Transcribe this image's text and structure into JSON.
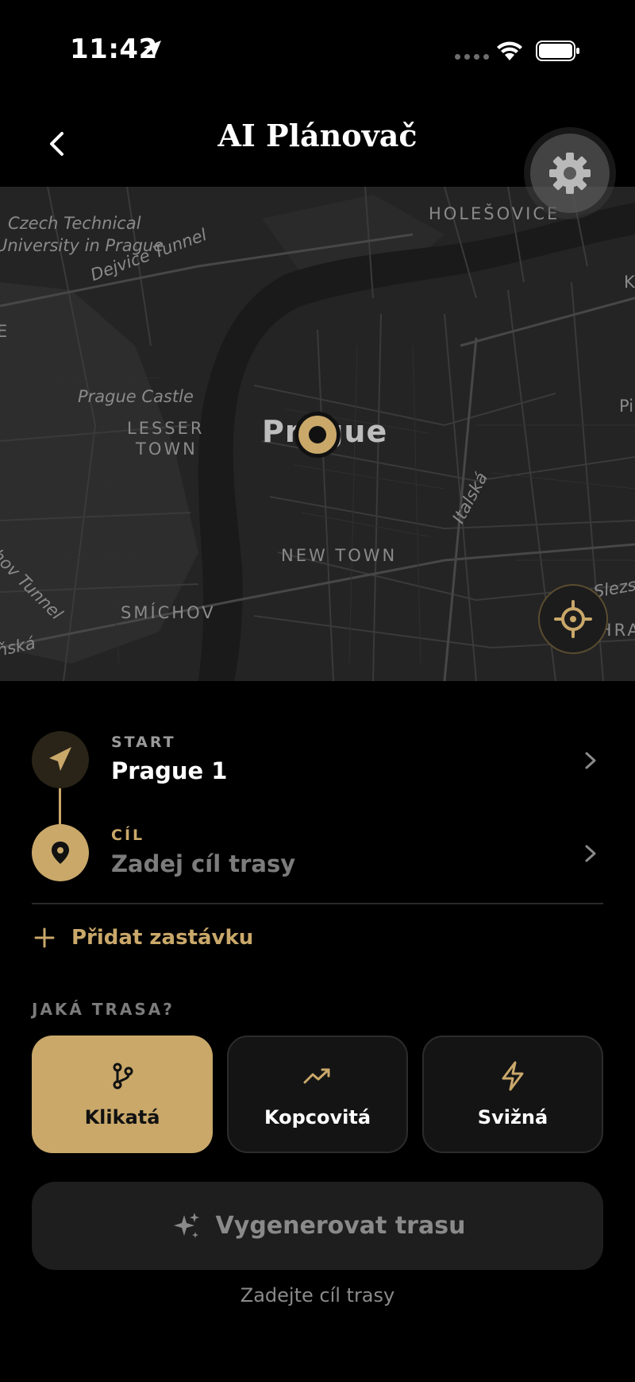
{
  "status_bar": {
    "time": "11:42"
  },
  "header": {
    "title": "AI Plánovač"
  },
  "map": {
    "city": "Prague",
    "labels": {
      "czech_tech_1": "Czech Technical",
      "czech_tech_2": "University in Prague",
      "holesovice": "HOLEŠOVICE",
      "dejvice_tunnel": "Dejvice Tunnel",
      "prague_castle": "Prague Castle",
      "lesser_1": "LESSER",
      "lesser_2": "TOWN",
      "new_town": "NEW TOWN",
      "italska": "Italská",
      "tunnel_left": "hov Tunnel",
      "smichov": "SMÍCHOV",
      "left_edge_bottom": "ňská",
      "left_edge_mid": "E",
      "right_edge_top": "K",
      "right_edge_mid": "Pi",
      "slezska": "Slezs",
      "vinohrady": "VINOHRAD"
    }
  },
  "route": {
    "start_label": "START",
    "start_value": "Prague 1",
    "destination_label": "CÍL",
    "destination_placeholder": "Zadej cíl trasy",
    "add_stop": "Přidat zastávku"
  },
  "route_type": {
    "title": "JAKÁ TRASA?",
    "options": [
      {
        "label": "Klikatá",
        "icon": "branch-icon",
        "selected": true
      },
      {
        "label": "Kopcovitá",
        "icon": "trending-up-icon",
        "selected": false
      },
      {
        "label": "Svižná",
        "icon": "lightning-icon",
        "selected": false
      }
    ]
  },
  "generate_button": {
    "label": "Vygenerovat trasu",
    "icon": "sparkles-icon"
  },
  "hint": "Zadejte cíl trasy",
  "colors": {
    "accent": "#c9a86a",
    "background": "#000000",
    "map": "#242424"
  }
}
